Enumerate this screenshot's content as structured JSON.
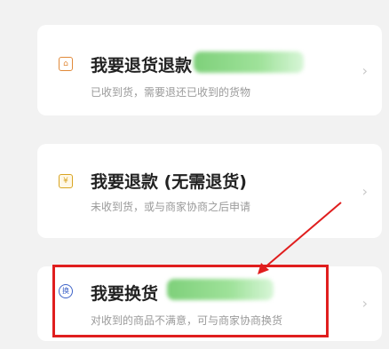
{
  "options": [
    {
      "title": "我要退货退款",
      "subtitle": "已收到货，需要退还已收到的货物",
      "icon": "return-box-icon"
    },
    {
      "title": "我要退款 (无需退货)",
      "subtitle": "未收到货，或与商家协商之后申请",
      "icon": "yen-icon"
    },
    {
      "title": "我要换货",
      "subtitle": "对收到的商品不满意，可与商家协商换货",
      "icon": "exchange-icon"
    }
  ],
  "icon_glyphs": {
    "c1": "⌂",
    "c2": "¥",
    "c3": "换"
  },
  "chevron": "›",
  "colors": {
    "highlight": "#e01e1e",
    "blur": "#7ed07a"
  }
}
